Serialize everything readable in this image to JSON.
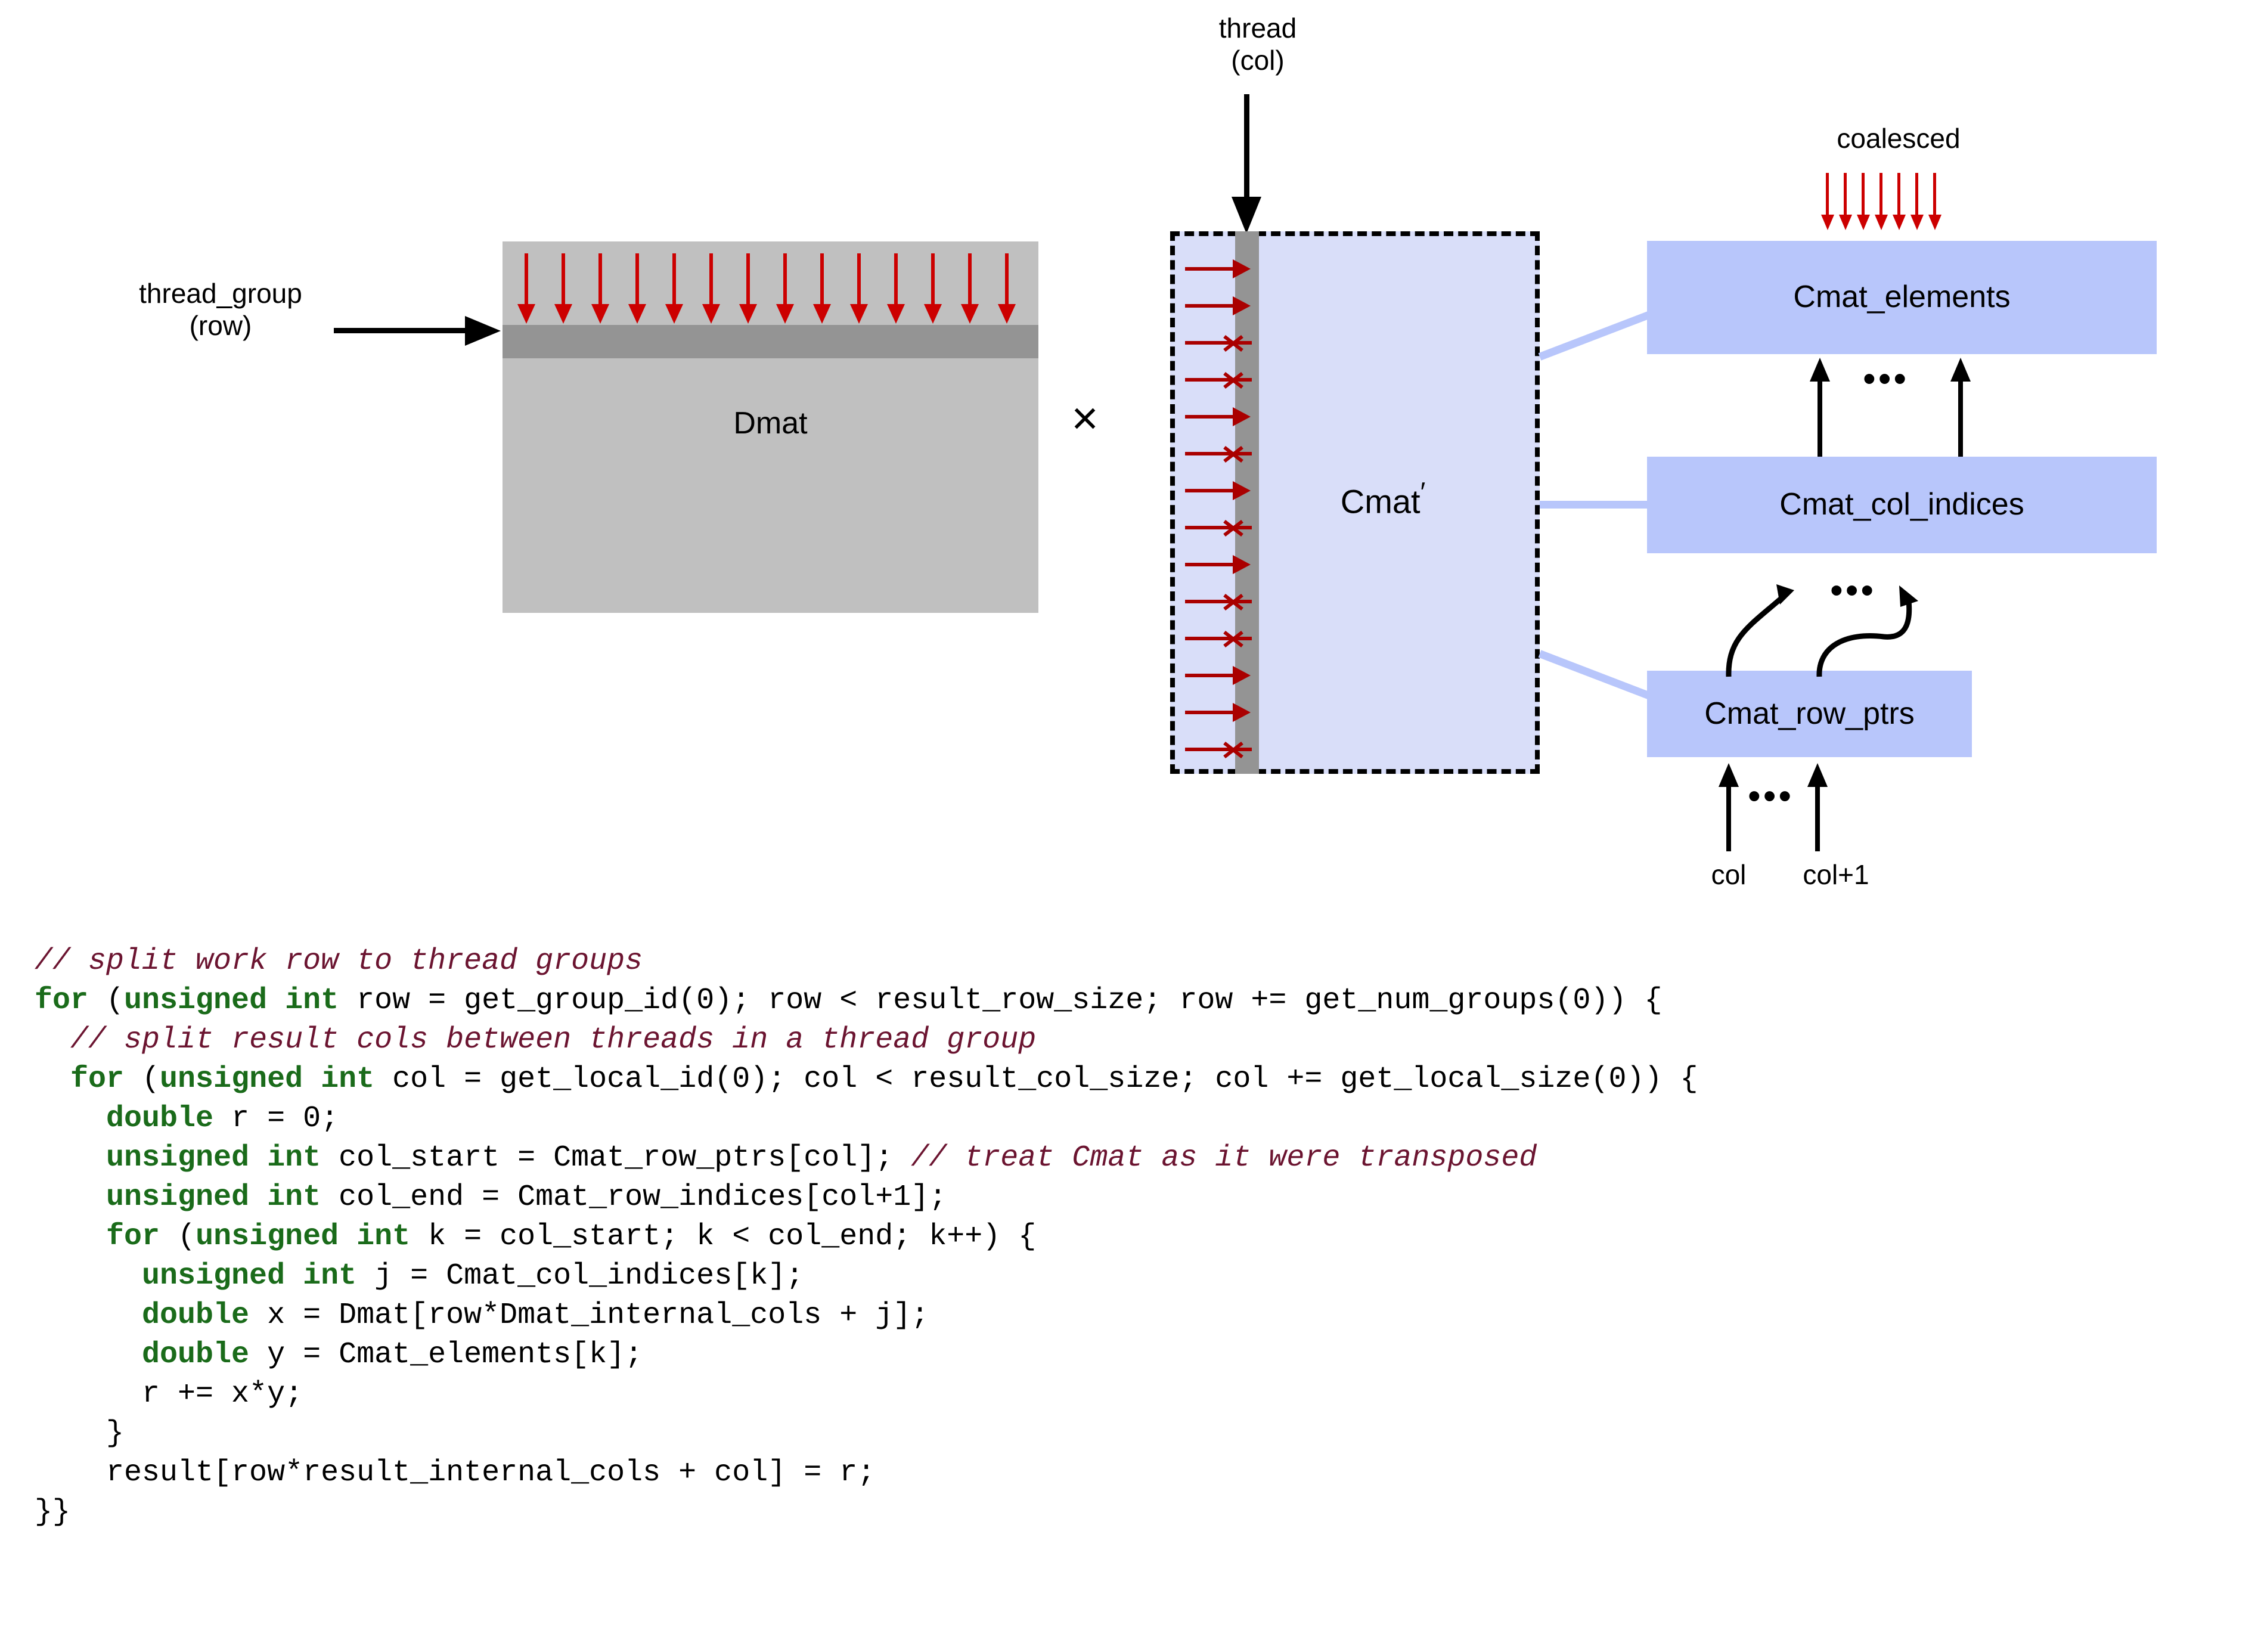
{
  "diagram": {
    "thread_group_label": "thread_group\n(row)",
    "thread_col_label": "thread\n(col)",
    "dmat_label": "Dmat",
    "times_symbol": "×",
    "cmat_label": "Cmat",
    "cmat_prime": "′",
    "coalesced_label": "coalesced",
    "boxes": [
      {
        "id": "cmat_elements",
        "label": "Cmat_elements"
      },
      {
        "id": "cmat_col_indices",
        "label": "Cmat_col_indices"
      },
      {
        "id": "cmat_row_ptrs",
        "label": "Cmat_row_ptrs"
      }
    ],
    "index_labels": {
      "col": "col",
      "col_plus_1": "col+1"
    },
    "ellipsis": "•••",
    "dmat_down_arrow_count": 14,
    "coalesced_arrow_count": 7,
    "cmat_row_marks": [
      "arrow",
      "arrow",
      "x",
      "x",
      "arrow",
      "x",
      "arrow",
      "x",
      "arrow",
      "x",
      "x",
      "arrow",
      "arrow",
      "x"
    ],
    "colors": {
      "dmat_fill": "#c0c0c0",
      "dmat_band": "#949494",
      "cmat_fill": "#d9def9",
      "cmat_band": "#949494",
      "box_fill": "#b8c6fb",
      "red_arrow": "#cc0000",
      "dark_red_arrow": "#aa0000",
      "connector": "#b8c6fb",
      "black": "#000000"
    }
  },
  "code": {
    "lines": [
      [
        {
          "t": "c",
          "s": "// split work row to thread groups"
        }
      ],
      [
        {
          "t": "k",
          "s": "for"
        },
        {
          "t": "p",
          "s": " ("
        },
        {
          "t": "k",
          "s": "unsigned int"
        },
        {
          "t": "p",
          "s": " row = get_group_id(0); row < result_row_size; row += get_num_groups(0)) {"
        }
      ],
      [
        {
          "t": "p",
          "s": "  "
        },
        {
          "t": "c",
          "s": "// split result cols between threads in a thread group"
        }
      ],
      [
        {
          "t": "p",
          "s": "  "
        },
        {
          "t": "k",
          "s": "for"
        },
        {
          "t": "p",
          "s": " ("
        },
        {
          "t": "k",
          "s": "unsigned int"
        },
        {
          "t": "p",
          "s": " col = get_local_id(0); col < result_col_size; col += get_local_size(0)) {"
        }
      ],
      [
        {
          "t": "p",
          "s": "    "
        },
        {
          "t": "k",
          "s": "double"
        },
        {
          "t": "p",
          "s": " r = 0;"
        }
      ],
      [
        {
          "t": "p",
          "s": "    "
        },
        {
          "t": "k",
          "s": "unsigned int"
        },
        {
          "t": "p",
          "s": " col_start = Cmat_row_ptrs[col]; "
        },
        {
          "t": "c",
          "s": "// treat Cmat as it were transposed"
        }
      ],
      [
        {
          "t": "p",
          "s": "    "
        },
        {
          "t": "k",
          "s": "unsigned int"
        },
        {
          "t": "p",
          "s": " col_end = Cmat_row_indices[col+1];"
        }
      ],
      [
        {
          "t": "p",
          "s": "    "
        },
        {
          "t": "k",
          "s": "for"
        },
        {
          "t": "p",
          "s": " ("
        },
        {
          "t": "k",
          "s": "unsigned int"
        },
        {
          "t": "p",
          "s": " k = col_start; k < col_end; k++) {"
        }
      ],
      [
        {
          "t": "p",
          "s": "      "
        },
        {
          "t": "k",
          "s": "unsigned int"
        },
        {
          "t": "p",
          "s": " j = Cmat_col_indices[k];"
        }
      ],
      [
        {
          "t": "p",
          "s": "      "
        },
        {
          "t": "k",
          "s": "double"
        },
        {
          "t": "p",
          "s": " x = Dmat[row*Dmat_internal_cols + j];"
        }
      ],
      [
        {
          "t": "p",
          "s": "      "
        },
        {
          "t": "k",
          "s": "double"
        },
        {
          "t": "p",
          "s": " y = Cmat_elements[k];"
        }
      ],
      [
        {
          "t": "p",
          "s": "      r += x*y;"
        }
      ],
      [
        {
          "t": "p",
          "s": "    }"
        }
      ],
      [
        {
          "t": "p",
          "s": "    result[row*result_internal_cols + col] = r;"
        }
      ],
      [
        {
          "t": "p",
          "s": "}}"
        }
      ]
    ]
  }
}
